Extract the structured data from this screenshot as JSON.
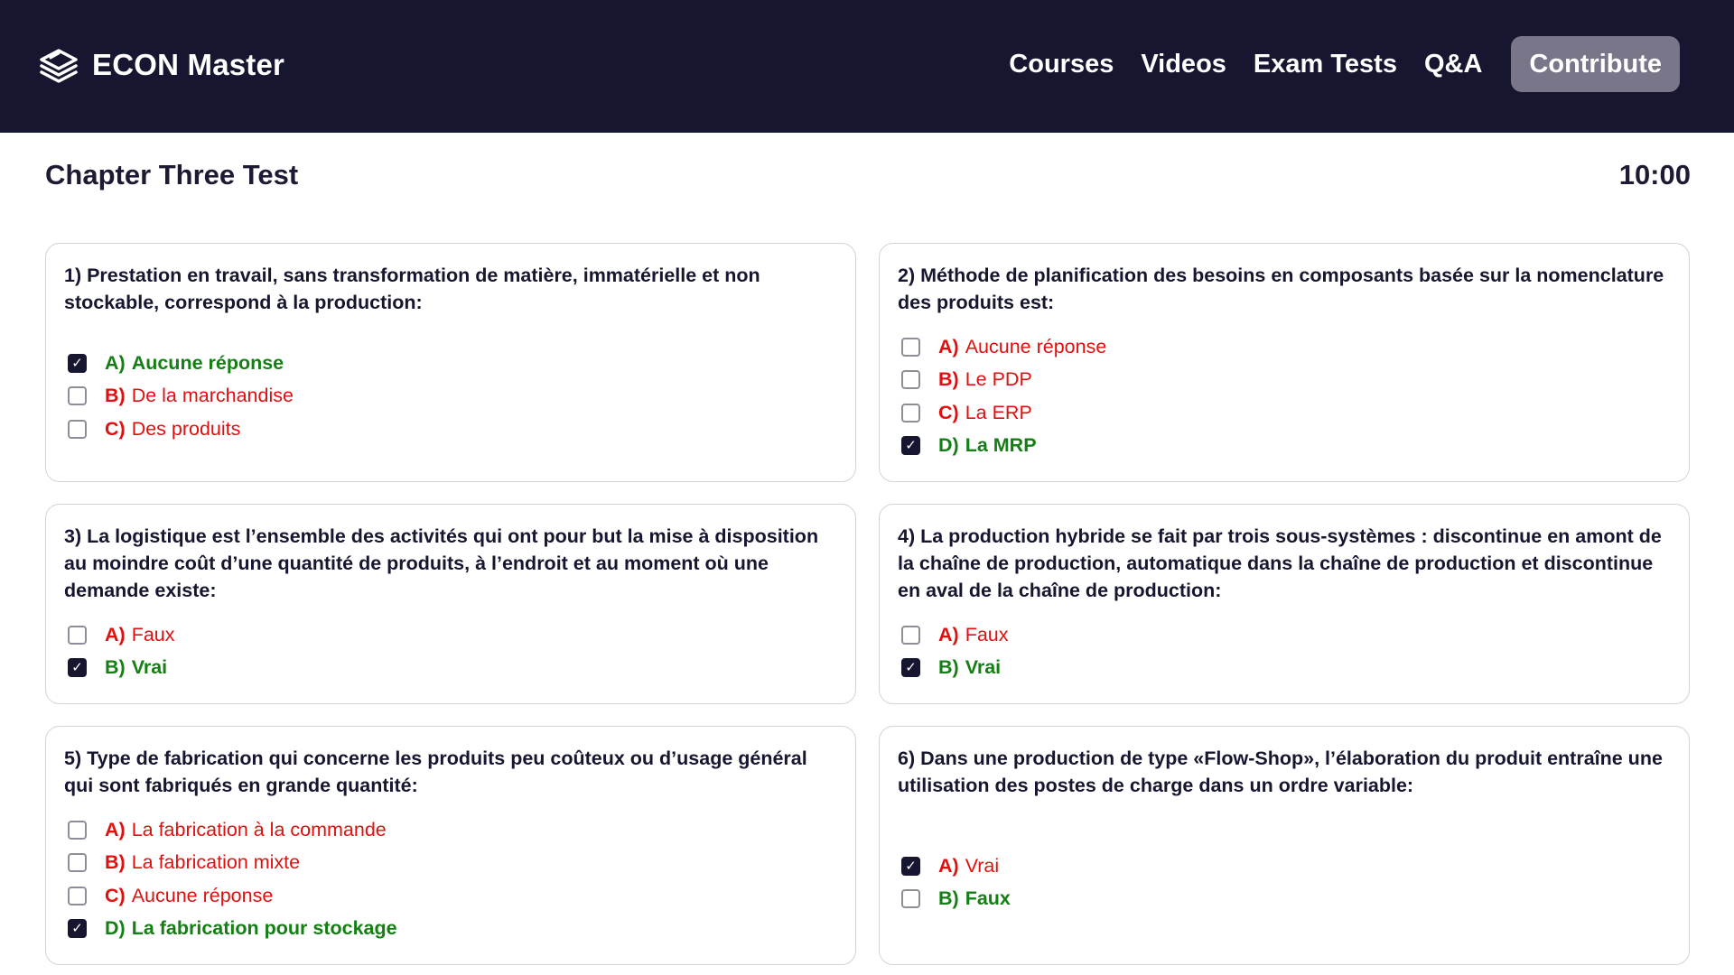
{
  "app": {
    "name": "ECON Master",
    "nav": [
      "Courses",
      "Videos",
      "Exam Tests",
      "Q&A"
    ],
    "contribute_label": "Contribute"
  },
  "test": {
    "title": "Chapter Three Test",
    "timer": "10:00"
  },
  "questions": [
    {
      "text": "1) Prestation en travail, sans transformation de matière, immatérielle et non stockable, correspond à la production:",
      "options": [
        {
          "letter": "A)",
          "label": "Aucune réponse",
          "checked": true,
          "status": "correct"
        },
        {
          "letter": "B)",
          "label": "De la marchandise",
          "checked": false,
          "status": "wrong"
        },
        {
          "letter": "C)",
          "label": "Des produits",
          "checked": false,
          "status": "wrong"
        }
      ]
    },
    {
      "text": "2) Méthode de planification des besoins en composants basée sur la nomenclature des produits est:",
      "options": [
        {
          "letter": "A)",
          "label": "Aucune réponse",
          "checked": false,
          "status": "wrong"
        },
        {
          "letter": "B)",
          "label": "Le PDP",
          "checked": false,
          "status": "wrong"
        },
        {
          "letter": "C)",
          "label": "La ERP",
          "checked": false,
          "status": "wrong"
        },
        {
          "letter": "D)",
          "label": "La MRP",
          "checked": true,
          "status": "correct"
        }
      ]
    },
    {
      "text": "3) La logistique est l’ensemble des activités qui ont pour but la mise à disposition au moindre coût d’une quantité de produits, à l’endroit et au moment où une demande existe:",
      "options": [
        {
          "letter": "A)",
          "label": "Faux",
          "checked": false,
          "status": "wrong"
        },
        {
          "letter": "B)",
          "label": "Vrai",
          "checked": true,
          "status": "correct"
        }
      ]
    },
    {
      "text": "4) La production hybride se fait par trois sous-systèmes : discontinue en amont de la chaîne de production, automatique dans la chaîne de production et discontinue en aval de la chaîne de production:",
      "options": [
        {
          "letter": "A)",
          "label": "Faux",
          "checked": false,
          "status": "wrong"
        },
        {
          "letter": "B)",
          "label": "Vrai",
          "checked": true,
          "status": "correct"
        }
      ]
    },
    {
      "text": "5) Type de fabrication qui concerne les produits peu coûteux ou d’usage général qui sont fabriqués en grande quantité:",
      "options": [
        {
          "letter": "A)",
          "label": "La fabrication à la commande",
          "checked": false,
          "status": "wrong"
        },
        {
          "letter": "B)",
          "label": "La fabrication mixte",
          "checked": false,
          "status": "wrong"
        },
        {
          "letter": "C)",
          "label": "Aucune réponse",
          "checked": false,
          "status": "wrong"
        },
        {
          "letter": "D)",
          "label": "La fabrication pour stockage",
          "checked": true,
          "status": "correct"
        }
      ]
    },
    {
      "text": "6) Dans une production de type «Flow-Shop», l’élaboration du produit entraîne une utilisation des postes de charge dans un ordre variable:",
      "options": [
        {
          "letter": "A)",
          "label": "Vrai",
          "checked": true,
          "status": "wrong"
        },
        {
          "letter": "B)",
          "label": "Faux",
          "checked": false,
          "status": "correct"
        }
      ]
    }
  ]
}
